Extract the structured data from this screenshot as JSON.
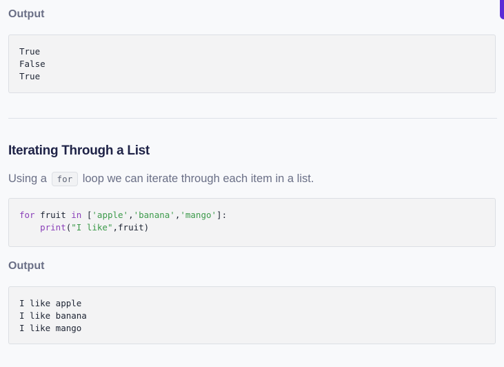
{
  "output_section_1": {
    "label": "Output",
    "lines": [
      "True",
      "False",
      "True"
    ]
  },
  "section": {
    "title": "Iterating Through a List",
    "description_before": "Using a",
    "inline_code": "for",
    "description_after": "loop we can iterate through each item in a list."
  },
  "code_example": {
    "line1": {
      "keyword_for": "for",
      "var": " fruit ",
      "keyword_in": "in",
      "bracket_open": " [",
      "item1": "'apple'",
      "comma1": ",",
      "item2": "'banana'",
      "comma2": ",",
      "item3": "'mango'",
      "bracket_close": "]:"
    },
    "line2": {
      "indent": "    ",
      "func": "print",
      "paren_open": "(",
      "string": "\"I like\"",
      "args_rest": ",fruit)"
    }
  },
  "output_section_2": {
    "label": "Output",
    "lines": [
      "I like apple",
      "I like banana",
      "I like mango"
    ]
  },
  "colors": {
    "accent": "#5b2bd6",
    "keyword": "#8a3fb8",
    "string": "#3c9a4a"
  }
}
